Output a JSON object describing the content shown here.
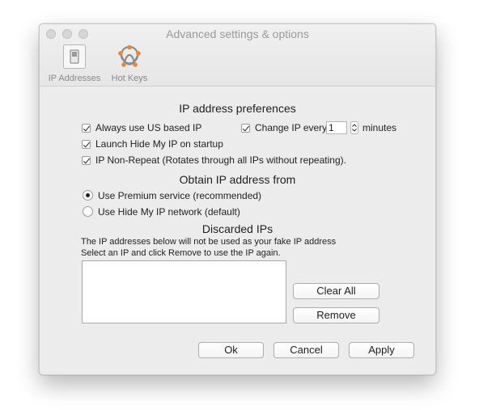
{
  "window": {
    "title": "Advanced settings & options"
  },
  "toolbar": {
    "items": [
      {
        "label": "IP Addresses",
        "icon": "switch-icon"
      },
      {
        "label": "Hot Keys",
        "icon": "hotkeys-knot-icon"
      }
    ]
  },
  "ip_prefs": {
    "heading": "IP address preferences",
    "always_us": {
      "label": "Always use US based IP",
      "checked": true
    },
    "change_ip": {
      "label": "Change IP every",
      "checked": true,
      "value": "1",
      "unit": "minutes"
    },
    "launch_startup": {
      "label": "Launch Hide My IP on startup",
      "checked": true
    },
    "non_repeat": {
      "label": "IP Non-Repeat (Rotates through all IPs without repeating).",
      "checked": true
    }
  },
  "obtain": {
    "heading": "Obtain IP address from",
    "options": [
      {
        "label": "Use Premium service (recommended)",
        "selected": true
      },
      {
        "label": "Use Hide My IP network (default)",
        "selected": false
      }
    ]
  },
  "discarded": {
    "heading": "Discarded IPs",
    "line1": "The IP addresses below will not be used as your fake IP address",
    "line2": "Select an IP and click Remove to use the IP again.",
    "items": [],
    "clear_all_label": "Clear All",
    "remove_label": "Remove"
  },
  "footer": {
    "ok_label": "Ok",
    "cancel_label": "Cancel",
    "apply_label": "Apply"
  },
  "colors": {
    "window_bg": "#ececec",
    "title_text": "#9a9a9a",
    "knot_orange": "#e8863a"
  }
}
